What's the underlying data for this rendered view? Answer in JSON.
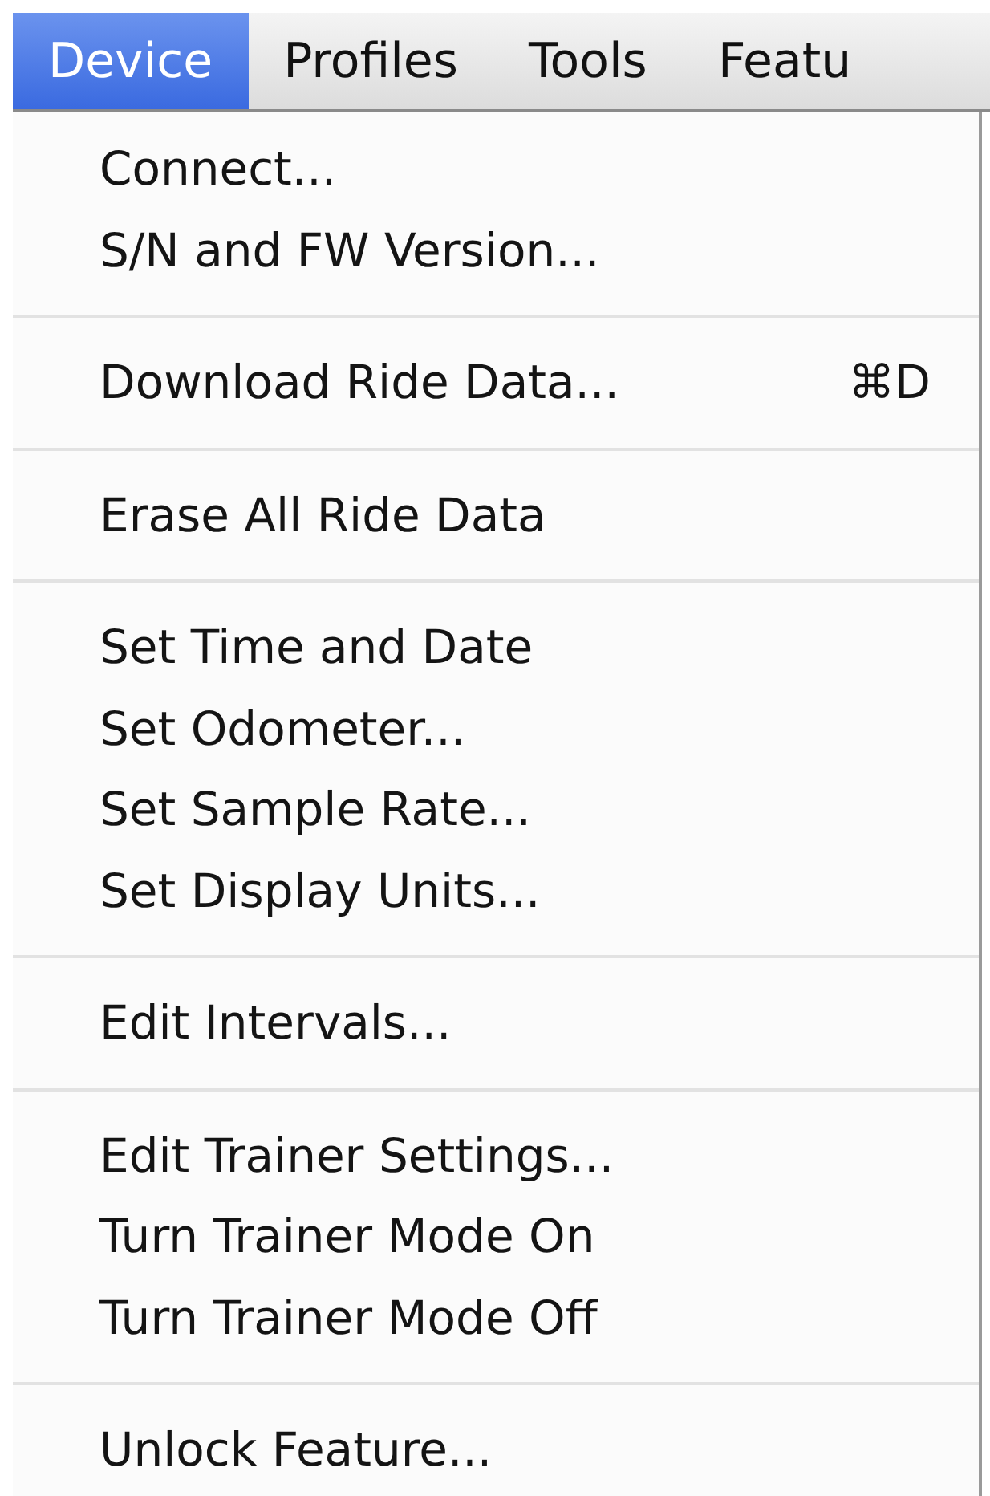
{
  "menu_bar": [
    {
      "label": "Device",
      "selected": true
    },
    {
      "label": "Profiles",
      "selected": false
    },
    {
      "label": "Tools",
      "selected": false
    },
    {
      "label": "Featu",
      "selected": false
    }
  ],
  "menu": [
    {
      "kind": "item",
      "label": "Connect..."
    },
    {
      "kind": "item",
      "label": "S/N and FW Version..."
    },
    {
      "kind": "separator"
    },
    {
      "kind": "item",
      "label": "Download Ride Data...",
      "shortcut": "⌘D"
    },
    {
      "kind": "separator"
    },
    {
      "kind": "item",
      "label": "Erase All Ride Data"
    },
    {
      "kind": "separator"
    },
    {
      "kind": "item",
      "label": "Set Time and Date"
    },
    {
      "kind": "item",
      "label": "Set Odometer..."
    },
    {
      "kind": "item",
      "label": "Set Sample Rate..."
    },
    {
      "kind": "item",
      "label": "Set Display Units..."
    },
    {
      "kind": "separator"
    },
    {
      "kind": "item",
      "label": "Edit Intervals..."
    },
    {
      "kind": "separator"
    },
    {
      "kind": "item",
      "label": "Edit Trainer Settings..."
    },
    {
      "kind": "item",
      "label": "Turn Trainer Mode On"
    },
    {
      "kind": "item",
      "label": "Turn Trainer Mode Off"
    },
    {
      "kind": "separator"
    },
    {
      "kind": "item",
      "label": "Unlock Feature..."
    }
  ]
}
